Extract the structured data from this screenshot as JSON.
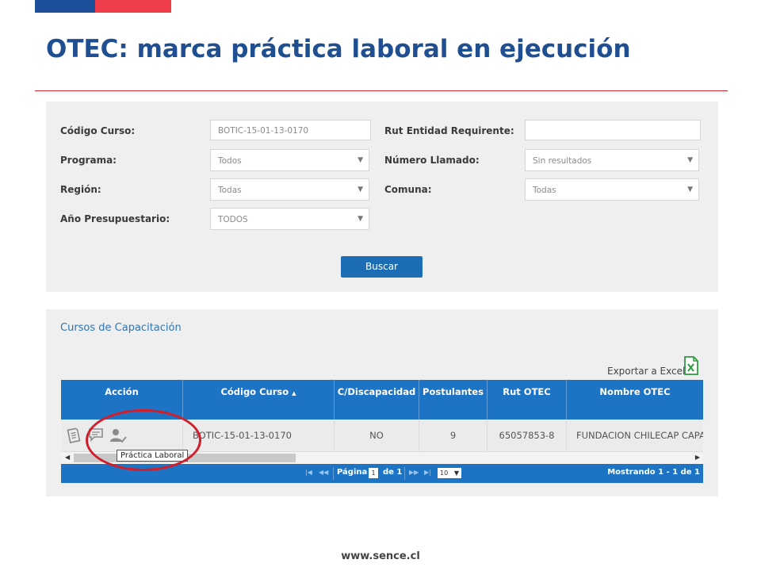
{
  "slide": {
    "title": "OTEC: marca práctica laboral en ejecución",
    "footer": "www.sence.cl",
    "brand_colors": [
      "#1c4e9c",
      "#ef3e4a"
    ]
  },
  "filters": {
    "codigo_curso": {
      "label": "Código Curso:",
      "value": "BOTIC-15-01-13-0170"
    },
    "rut_entidad": {
      "label": "Rut Entidad Requirente:",
      "value": ""
    },
    "programa": {
      "label": "Programa:",
      "value": "Todos"
    },
    "numero_llamado": {
      "label": "Número Llamado:",
      "value": "Sin resultados"
    },
    "region": {
      "label": "Región:",
      "value": "Todas"
    },
    "comuna": {
      "label": "Comuna:",
      "value": "Todas"
    },
    "anio": {
      "label": "Año Presupuestario:",
      "value": "TODOS"
    },
    "search_button": "Buscar"
  },
  "results": {
    "title": "Cursos de Capacitación",
    "export_label": "Exportar a Excel",
    "columns": [
      "Acción",
      "Código Curso",
      "C/Discapacidad",
      "Postulantes",
      "Rut OTEC",
      "Nombre OTEC"
    ],
    "sort_indicator": "▲",
    "rows": [
      {
        "codigo": "BOTIC-15-01-13-0170",
        "discapacidad": "NO",
        "postulantes": "9",
        "rut": "65057853-8",
        "nombre": "FUNDACION CHILECAP CAPA"
      }
    ],
    "action_icons": [
      "document-icon",
      "comment-icon",
      "user-check-icon"
    ],
    "tooltip": "Práctica Laboral",
    "pager": {
      "page_label": "Página",
      "page_value": "1",
      "of_label": "de 1",
      "page_size": "10",
      "summary": "Mostrando 1 - 1 de 1"
    }
  }
}
